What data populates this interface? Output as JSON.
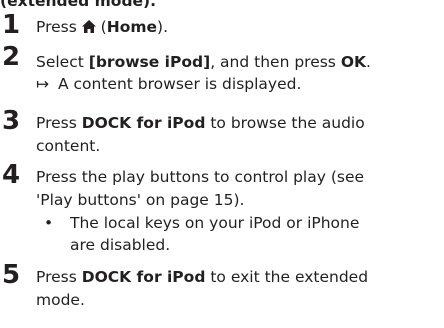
{
  "header": {
    "text": "(extended mode)."
  },
  "steps": [
    {
      "num": "1",
      "pre": "Press ",
      "icon": "home-icon",
      "post_open": " (",
      "bold": "Home",
      "post_close": ")."
    },
    {
      "num": "2",
      "pre": "Select ",
      "bold1": "[browse iPod]",
      "mid": ", and then press ",
      "bold2": "OK",
      "end": ".",
      "result_arrow": "↦",
      "result_text": "A content browser is displayed."
    },
    {
      "num": "3",
      "pre": "Press ",
      "bold": "DOCK for iPod",
      "post": " to browse the audio",
      "line2": "content."
    },
    {
      "num": "4",
      "line1": "Press the play buttons to control play (see",
      "line2": "'Play buttons' on page 15).",
      "bullet": "•",
      "bullet_line1": "The local keys on your iPod or iPhone",
      "bullet_line2": "are disabled."
    },
    {
      "num": "5",
      "pre": "Press ",
      "bold": "DOCK for iPod",
      "post": " to exit the extended",
      "line2": "mode."
    }
  ]
}
